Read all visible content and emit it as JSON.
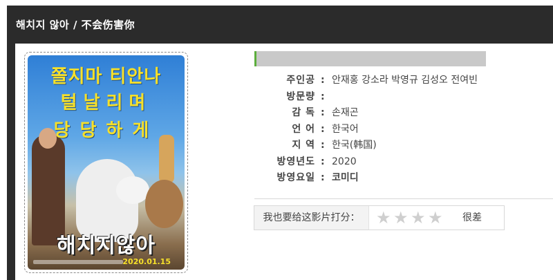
{
  "page": {
    "title": "해치지 않아 / 不会伤害你"
  },
  "poster": {
    "tagline_1": "쫄지마 티안나",
    "tagline_2": "털날리며",
    "tagline_3": "당당하게",
    "movie_title": "해치지않아",
    "release_date": "2020.01.15"
  },
  "info": {
    "rows": [
      {
        "label": "주인공",
        "value": "안재홍 강소라 박영규 김성오 전여빈"
      },
      {
        "label": "방문량",
        "value": ""
      },
      {
        "label": "감 독",
        "value": "손재곤"
      },
      {
        "label": "언 어",
        "value": "한국어"
      },
      {
        "label": "지 역",
        "value": "한국(韩国)"
      },
      {
        "label": "방영년도",
        "value": "2020"
      },
      {
        "label": "방영요일",
        "value": "코미디"
      }
    ]
  },
  "rating": {
    "prompt": "我也要给这影片打分：",
    "stars": [
      "☆",
      "☆",
      "☆",
      "☆"
    ],
    "star_count": 4,
    "filled": 0,
    "result_text": "很差"
  },
  "colors": {
    "header_bg": "#2b2b2b",
    "bar_accent": "#5cae3c",
    "bar_bg": "#c9c9c9"
  }
}
